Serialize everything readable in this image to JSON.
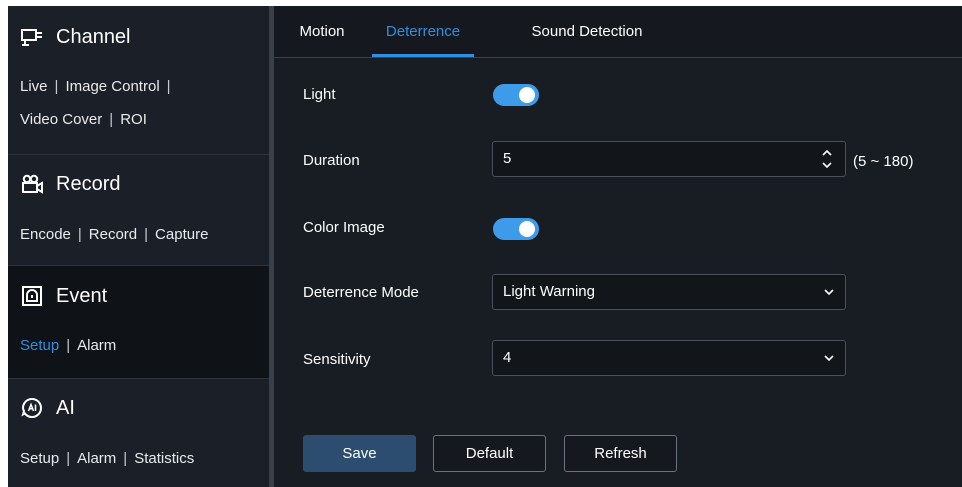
{
  "sidebar": {
    "channel": {
      "title": "Channel",
      "links": [
        "Live",
        "Image Control",
        "Video Cover",
        "ROI"
      ]
    },
    "record": {
      "title": "Record",
      "links": [
        "Encode",
        "Record",
        "Capture"
      ]
    },
    "event": {
      "title": "Event",
      "links": [
        "Setup",
        "Alarm"
      ],
      "active_link": "Setup"
    },
    "ai": {
      "title": "AI",
      "links": [
        "Setup",
        "Alarm",
        "Statistics"
      ]
    }
  },
  "tabs": [
    "Motion",
    "Deterrence",
    "Sound Detection"
  ],
  "active_tab": "Deterrence",
  "form": {
    "light": {
      "label": "Light",
      "enabled": true
    },
    "duration": {
      "label": "Duration",
      "value": "5",
      "range": "(5 ~ 180)"
    },
    "color_image": {
      "label": "Color Image",
      "enabled": true
    },
    "deterrence_mode": {
      "label": "Deterrence Mode",
      "value": "Light Warning"
    },
    "sensitivity": {
      "label": "Sensitivity",
      "value": "4"
    }
  },
  "buttons": {
    "save": "Save",
    "default": "Default",
    "refresh": "Refresh"
  },
  "colors": {
    "accent": "#2f8ee0",
    "toggle_on": "#3d9bea",
    "save_bg": "#2c4d6f"
  }
}
